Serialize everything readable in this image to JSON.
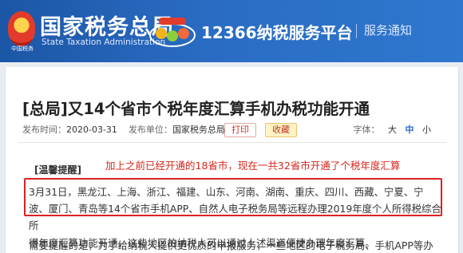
{
  "header": {
    "emblem_text": "中国税务",
    "site_title": "国家税务总局",
    "site_subtitle": "State Taxation Administration",
    "platform_logo_icon": "12366-logo-icon",
    "platform_name": "12366纳税服务平台",
    "section_name": "服务通知"
  },
  "article": {
    "title": "[总局]又14个省市个税年度汇算手机办税功能开通",
    "publish_label": "发布时间：",
    "publish_date": "2020-03-31",
    "unit_label": "发布单位：",
    "unit_value": "国家税务总局",
    "print_label": "打印",
    "favorite_label": "收藏",
    "font_label": "字体：",
    "font_large": "大",
    "font_medium": "中",
    "font_small": "小",
    "tip_label": "[温馨提醒]",
    "annotation": "加上之前已经开通的18省市，现在一共32省市开通了个税年度汇算",
    "para_line1": "3月31日，黑龙江、上海、浙江、福建、山东、河南、湖南、重庆、四川、西藏、宁夏、宁",
    "para_line2": "波、厦门、青岛等14个省市手机APP、自然人电子税务局等远程办理2019年度个人所得税综合所",
    "para_line3": "得年度汇算功能开通，这些地区的纳税人可以通过上述渠道便捷办理年度汇算。",
    "para_line4_cut": "需要提醒的是，为了给纳税人提供更优质的申报服务，一些地区的电子税务局、手机APP等办"
  },
  "colors": {
    "header_blue": "#2a6cc3",
    "highlight_red": "#e02020",
    "annotation_red": "#d7261b"
  }
}
